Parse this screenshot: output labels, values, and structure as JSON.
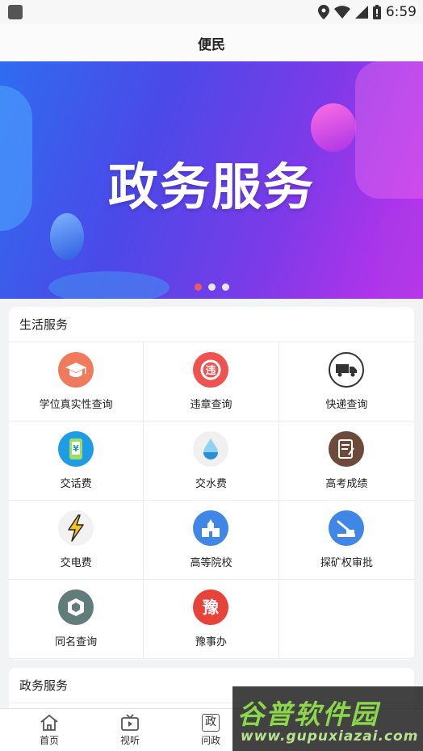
{
  "status_bar": {
    "time": "6:59"
  },
  "header": {
    "title": "便民"
  },
  "banner": {
    "title": "政务服务",
    "active_slide": 1,
    "slide_count": 3
  },
  "life_services": {
    "title": "生活服务",
    "items": [
      {
        "label": "学位真实性查询",
        "icon": "graduation-cap-icon",
        "color": "#f07a5c"
      },
      {
        "label": "违章查询",
        "icon": "traffic-violation-icon",
        "color": "#ef5350"
      },
      {
        "label": "快递查询",
        "icon": "delivery-truck-icon",
        "color": "#ffffff"
      },
      {
        "label": "交话费",
        "icon": "phone-bill-icon",
        "color": "#1e9de6"
      },
      {
        "label": "交水费",
        "icon": "water-drop-icon",
        "color": "#f0f0f0"
      },
      {
        "label": "高考成绩",
        "icon": "exam-score-icon",
        "color": "#6d4a3a"
      },
      {
        "label": "交电费",
        "icon": "lightning-icon",
        "color": "#f2f2f2"
      },
      {
        "label": "高等院校",
        "icon": "university-icon",
        "color": "#3f86e6"
      },
      {
        "label": "探矿权审批",
        "icon": "mining-approval-icon",
        "color": "#3f86e6"
      },
      {
        "label": "同名查询",
        "icon": "same-name-icon",
        "color": "#607d7b"
      },
      {
        "label": "豫事办",
        "icon": "yushiban-icon",
        "color": "#e8433b"
      }
    ]
  },
  "gov_services": {
    "title": "政务服务"
  },
  "tab_bar": {
    "tabs": [
      {
        "label": "首页",
        "icon": "home-icon"
      },
      {
        "label": "视听",
        "icon": "tv-icon"
      },
      {
        "label": "问政",
        "icon": "gov-icon",
        "glyph": "政"
      }
    ]
  },
  "watermark": {
    "title": "谷普软件园",
    "url": "www.gupuxiazai.com"
  }
}
